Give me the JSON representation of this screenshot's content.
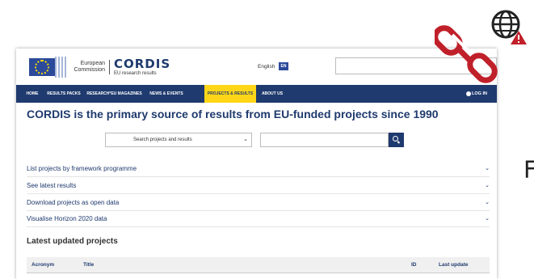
{
  "header": {
    "ec_line1": "European",
    "ec_line2": "Commission",
    "logo": "CORDIS",
    "logo_sub": "EU research results",
    "language": "English",
    "language_code": "EN",
    "search_value": ""
  },
  "nav": {
    "items": [
      {
        "label": "HOME",
        "active": false
      },
      {
        "label": "RESULTS PACKS",
        "active": false
      },
      {
        "label": "RESEARCH*EU MAGAZINES",
        "active": false
      },
      {
        "label": "NEWS & EVENTS",
        "active": false
      },
      {
        "label": "PROJECTS & RESULTS",
        "active": true
      },
      {
        "label": "ABOUT US",
        "active": false
      }
    ],
    "login": "LOG IN"
  },
  "main": {
    "headline": "CORDIS is the primary source of results from EU-funded projects since 1990",
    "search_select": "Search projects and results",
    "search_value": "",
    "accordion": [
      "List projects by framework programme",
      "See latest results",
      "Download projects as open data",
      "Visualise Horizon 2020 data"
    ],
    "latest_heading": "Latest updated projects",
    "table_headers": [
      "Acronym",
      "Title",
      "ID",
      "Last update"
    ]
  },
  "overlay": {
    "side_glyph": "F"
  },
  "colors": {
    "brand_blue": "#1f3a6e",
    "active_tab": "#ffd617",
    "warning_red": "#c0202a"
  },
  "icons": [
    "flag-icon",
    "chevron-down-icon",
    "search-icon",
    "user-icon",
    "globe-warning-icon",
    "broken-link-icon"
  ]
}
